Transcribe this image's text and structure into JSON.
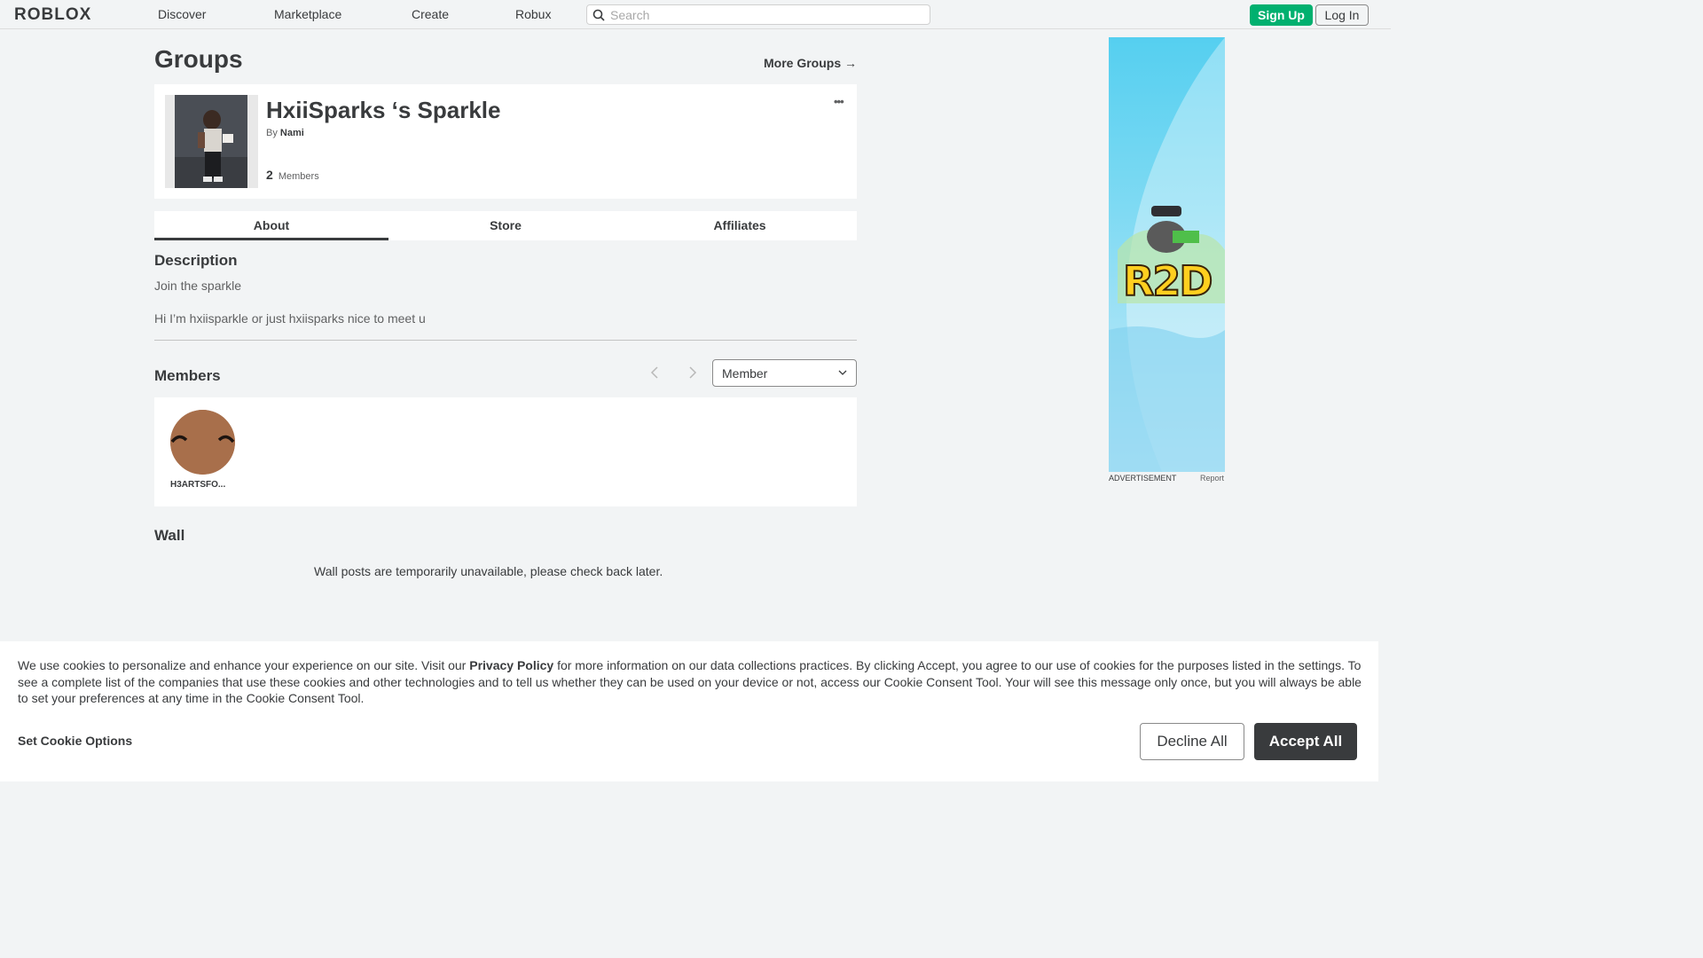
{
  "topnav": {
    "logo": "ROBLOX",
    "links": [
      "Discover",
      "Marketplace",
      "Create",
      "Robux"
    ],
    "search_placeholder": "Search",
    "signup": "Sign Up",
    "login": "Log In"
  },
  "page": {
    "title": "Groups",
    "more_groups": "More Groups →"
  },
  "group": {
    "name": "HxiiSparks ‘s Sparkle",
    "by_label": "By",
    "owner": "Nami",
    "member_count": "2",
    "members_label": "Members",
    "more_icon": "•••"
  },
  "tabs": [
    "About",
    "Store",
    "Affiliates"
  ],
  "description": {
    "title": "Description",
    "line1": "Join the sparkle",
    "line2": "Hi I’m hxiisparkle or just hxiisparks nice to meet u"
  },
  "members": {
    "title": "Members",
    "role_selected": "Member",
    "list": [
      {
        "name": "H3ARTSFO..."
      }
    ]
  },
  "wall": {
    "title": "Wall",
    "message": "Wall posts are temporarily unavailable, please check back later."
  },
  "ad": {
    "brand_text": "R2D",
    "label": "ADVERTISEMENT",
    "report": "Report"
  },
  "cookie": {
    "text_before": "We use cookies to personalize and enhance your experience on our site. Visit our ",
    "privacy_link": "Privacy Policy",
    "text_after": " for more information on our data collections practices. By clicking Accept, you agree to our use of cookies for the purposes listed in the settings. To see a complete list of the companies that use these cookies and other technologies and to tell us whether they can be used on your device or not, access our Cookie Consent Tool. Your will see this message only once, but you will always be able to set your preferences at any time in the Cookie Consent Tool.",
    "options": "Set Cookie Options",
    "decline": "Decline All",
    "accept": "Accept All"
  },
  "colors": {
    "signup_green": "#00b06f",
    "accept_dark": "#393b3d",
    "background": "#f2f4f5"
  }
}
